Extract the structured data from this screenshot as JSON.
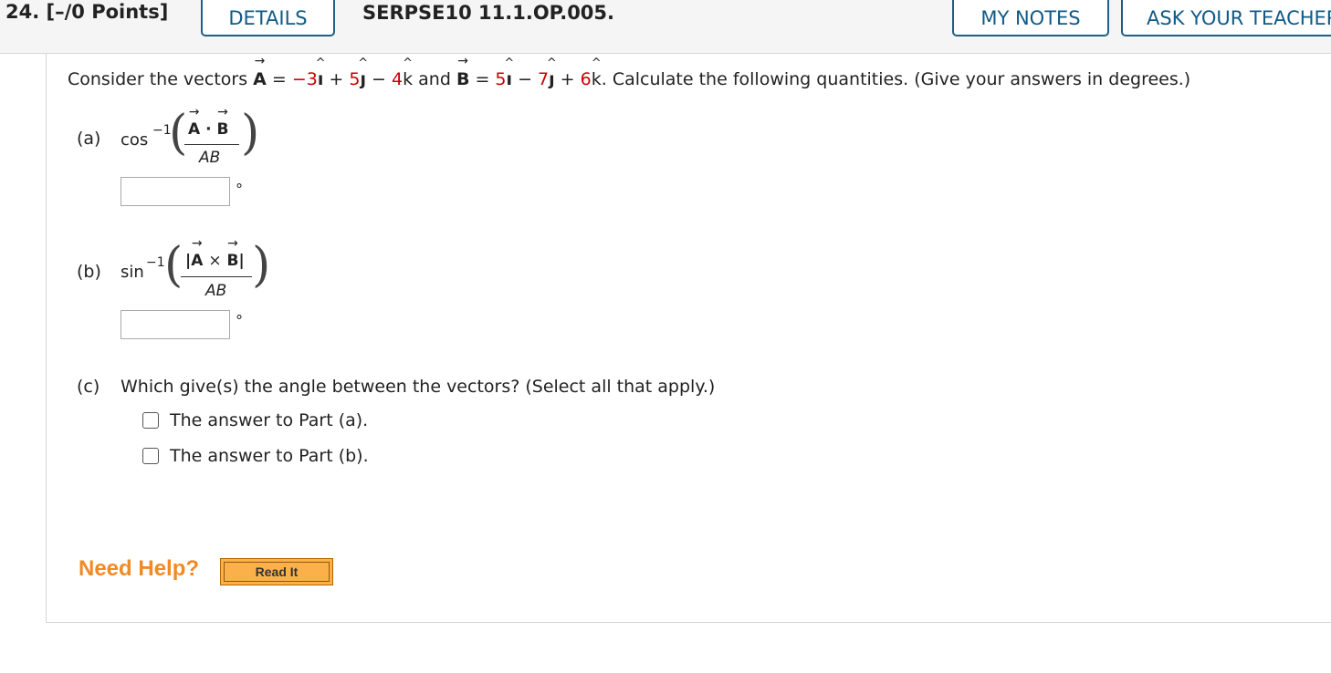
{
  "header": {
    "question_number": "24.",
    "points": "[–/0 Points]",
    "details_label": "DETAILS",
    "question_code": "SERPSE10 11.1.OP.005.",
    "my_notes_label": "MY NOTES",
    "ask_teacher_label": "ASK YOUR TEACHER"
  },
  "prompt": {
    "intro": "Consider the vectors ",
    "vec_a": "A",
    "eq": " = ",
    "a_i": "−3",
    "a_j": "5",
    "a_k": "4",
    "and": " and ",
    "vec_b": "B",
    "b_i": "5",
    "b_j": "7",
    "b_k": "6",
    "outro": ". Calculate the following quantities. (Give your answers in degrees.)"
  },
  "part_a": {
    "label": "(a)",
    "function": "cos",
    "exponent": "−1",
    "numerator_a": "A",
    "operator": "·",
    "numerator_b": "B",
    "denominator": "AB",
    "unit": "°",
    "value": ""
  },
  "part_b": {
    "label": "(b)",
    "function": "sin",
    "exponent": "−1",
    "numerator_a": "A",
    "operator": "×",
    "numerator_b": "B",
    "denominator": "AB",
    "unit": "°",
    "value": ""
  },
  "part_c": {
    "label": "(c)",
    "question": "Which give(s) the angle between the vectors? (Select all that apply.)",
    "options": [
      {
        "label": "The answer to Part (a).",
        "checked": false
      },
      {
        "label": "The answer to Part (b).",
        "checked": false
      }
    ]
  },
  "help": {
    "need_help": "Need Help?",
    "read_it": "Read It"
  }
}
